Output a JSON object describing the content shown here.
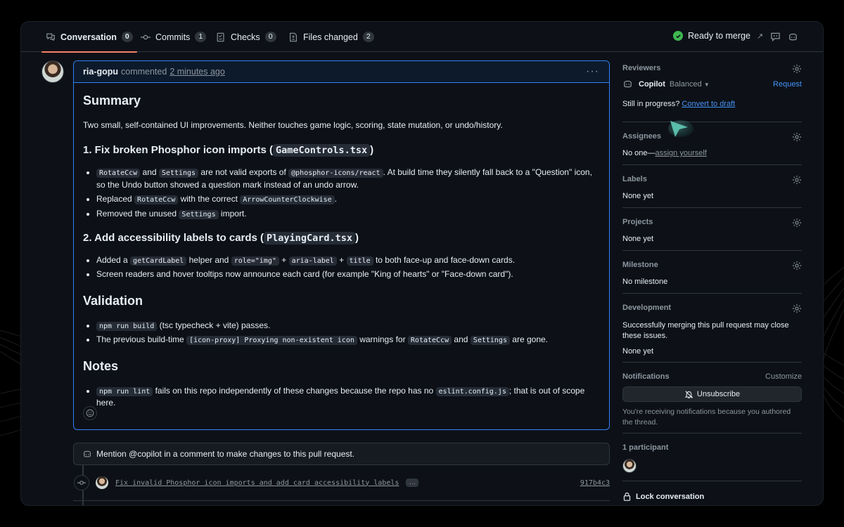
{
  "tabs": [
    {
      "label": "Conversation",
      "count": "0",
      "icon": "comment-discussion-icon"
    },
    {
      "label": "Commits",
      "count": "1",
      "icon": "git-commit-icon"
    },
    {
      "label": "Checks",
      "count": "0",
      "icon": "checklist-icon"
    },
    {
      "label": "Files changed",
      "count": "2",
      "icon": "file-diff-icon"
    }
  ],
  "merge_status": "Ready to merge",
  "comment": {
    "author": "ria-gopu",
    "verb": "commented",
    "time": "2 minutes ago",
    "summary_heading": "Summary",
    "intro": "Two small, self-contained UI improvements. Neither touches game logic, scoring, state mutation, or undo/history.",
    "s1": {
      "pre": "1. Fix broken Phosphor icon imports (",
      "code": "GameControls.tsx",
      "post": ")",
      "li1": {
        "c1": "RotateCcw",
        "t1": " and ",
        "c2": "Settings",
        "t2": " are not valid exports of ",
        "c3": "@phosphor-icons/react",
        "t3": ". At build time they silently fall back to a \"Question\" icon, so the Undo button showed a question mark instead of an undo arrow."
      },
      "li2": {
        "t0": "Replaced ",
        "c1": "RotateCcw",
        "t1": " with the correct ",
        "c2": "ArrowCounterClockwise",
        "t2": "."
      },
      "li3": {
        "t0": "Removed the unused ",
        "c1": "Settings",
        "t1": " import."
      }
    },
    "s2": {
      "pre": "2. Add accessibility labels to cards (",
      "code": "PlayingCard.tsx",
      "post": ")",
      "li1": {
        "t0": "Added a ",
        "c1": "getCardLabel",
        "t1": " helper and ",
        "c2": "role=\"img\"",
        "t2": " + ",
        "c3": "aria-label",
        "t3": " + ",
        "c4": "title",
        "t4": " to both face-up and face-down cards."
      },
      "li2": "Screen readers and hover tooltips now announce each card (for example \"King of hearts\" or \"Face-down card\")."
    },
    "validation_heading": "Validation",
    "v": {
      "li1": {
        "c1": "npm run build",
        "t1": " (tsc typecheck + vite) passes."
      },
      "li2": {
        "t0": "The previous build-time ",
        "c1": "[icon-proxy] Proxying non-existent icon",
        "t1": " warnings for ",
        "c2": "RotateCcw",
        "t2": " and ",
        "c3": "Settings",
        "t3": " are gone."
      }
    },
    "notes_heading": "Notes",
    "n": {
      "li1": {
        "c1": "npm run lint",
        "t1": " fails on this repo independently of these changes because the repo has no ",
        "c2": "eslint.config.js",
        "t2": "; that is out of scope here."
      }
    }
  },
  "mention_text": "Mention @copilot in a comment to make changes to this pull request.",
  "commit": {
    "message": "Fix invalid Phosphor icon imports and add card accessibility labels",
    "ellipsis": "…",
    "sha": "917b4c3"
  },
  "sidebar": {
    "reviewers": {
      "title": "Reviewers",
      "name": "Copilot",
      "mode": "Balanced",
      "request": "Request",
      "draft_pre": "Still in progress?",
      "draft_link": "Convert to draft"
    },
    "assignees": {
      "title": "Assignees",
      "pre": "No one—",
      "link": "assign yourself"
    },
    "labels": {
      "title": "Labels",
      "value": "None yet"
    },
    "projects": {
      "title": "Projects",
      "value": "None yet"
    },
    "milestone": {
      "title": "Milestone",
      "value": "No milestone"
    },
    "development": {
      "title": "Development",
      "desc": "Successfully merging this pull request may close these issues.",
      "value": "None yet"
    },
    "notifications": {
      "title": "Notifications",
      "customize": "Customize",
      "button": "Unsubscribe",
      "reason": "You're receiving notifications because you authored the thread."
    },
    "participants": {
      "title": "1 participant"
    },
    "lock": "Lock conversation"
  },
  "colors": {
    "accent": "#2f81f7",
    "link": "#4493f8",
    "success": "#3fb950",
    "tab_underline": "#f78166"
  }
}
